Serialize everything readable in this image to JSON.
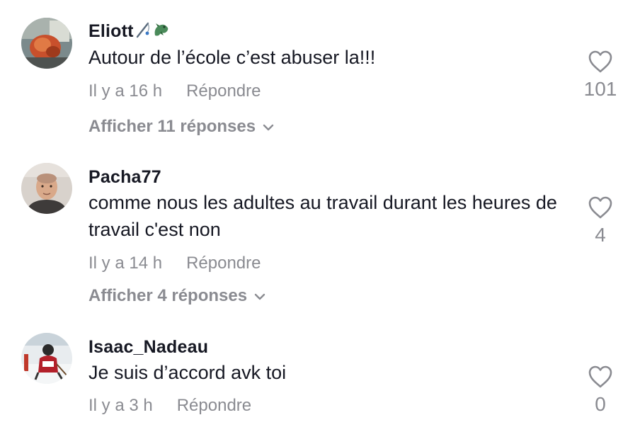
{
  "comments": [
    {
      "username": "Eliott",
      "username_emoji": [
        "fishing-pole-emoji",
        "dragon-emoji"
      ],
      "text": "Autour de l’école c’est abuser la!!!",
      "time": "Il y a 16 h",
      "reply_label": "Répondre",
      "likes": "101",
      "view_replies": "Afficher 11 réponses"
    },
    {
      "username": "Pacha77",
      "text": "comme nous les adultes au travail durant les heures de travail c'est non",
      "time": "Il y a 14 h",
      "reply_label": "Répondre",
      "likes": "4",
      "view_replies": "Afficher 4 réponses"
    },
    {
      "username": "Isaac_Nadeau",
      "text": "Je suis d’accord avk toi",
      "time": "Il y a 3 h",
      "reply_label": "Répondre",
      "likes": "0"
    }
  ],
  "colors": {
    "primary_text": "#161823",
    "secondary_text": "#8a8b91",
    "icon_gray": "#8a8b91"
  }
}
